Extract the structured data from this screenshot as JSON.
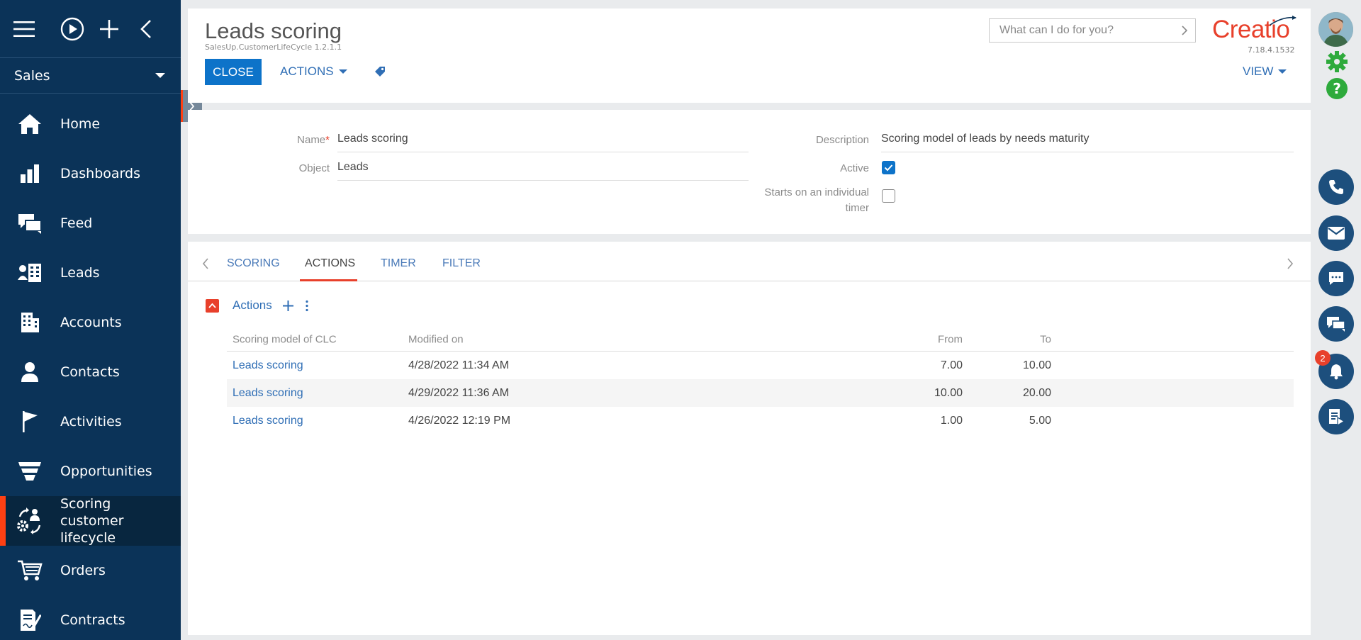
{
  "sidebar": {
    "workspace": "Sales",
    "items": [
      {
        "label": "Home",
        "icon": "home-icon"
      },
      {
        "label": "Dashboards",
        "icon": "dashboards-icon"
      },
      {
        "label": "Feed",
        "icon": "feed-icon"
      },
      {
        "label": "Leads",
        "icon": "leads-icon"
      },
      {
        "label": "Accounts",
        "icon": "accounts-icon"
      },
      {
        "label": "Contacts",
        "icon": "contacts-icon"
      },
      {
        "label": "Activities",
        "icon": "flag-icon"
      },
      {
        "label": "Opportunities",
        "icon": "funnel-icon"
      },
      {
        "label": "Scoring customer lifecycle",
        "icon": "scoring-icon",
        "active": true
      },
      {
        "label": "Orders",
        "icon": "cart-icon"
      },
      {
        "label": "Contracts",
        "icon": "contract-icon"
      }
    ]
  },
  "header": {
    "title": "Leads scoring",
    "subtitle": "SalesUp.CustomerLifeCycle 1.2.1.1",
    "close_label": "CLOSE",
    "actions_label": "ACTIONS",
    "view_label": "VIEW",
    "search_placeholder": "What can I do for you?",
    "logo_text": "Creatio",
    "version": "7.18.4.1532"
  },
  "form": {
    "name_label": "Name",
    "name_required_mark": "*",
    "name_value": "Leads scoring",
    "object_label": "Object",
    "object_value": "Leads",
    "description_label": "Description",
    "description_value": "Scoring model of leads by needs maturity",
    "active_label": "Active",
    "active_checked": true,
    "timer_label_line1": "Starts on an individual",
    "timer_label_line2": "timer",
    "timer_checked": false
  },
  "tabs": [
    "SCORING",
    "ACTIONS",
    "TIMER",
    "FILTER"
  ],
  "active_tab": "ACTIONS",
  "detail": {
    "title": "Actions",
    "columns": [
      "Scoring model of CLC",
      "Modified on",
      "From",
      "To"
    ],
    "rows": [
      [
        "Leads scoring",
        "4/28/2022 11:34 AM",
        "7.00",
        "10.00"
      ],
      [
        "Leads scoring",
        "4/29/2022 11:36 AM",
        "10.00",
        "20.00"
      ],
      [
        "Leads scoring",
        "4/26/2022 12:19 PM",
        "1.00",
        "5.00"
      ]
    ]
  },
  "rail": {
    "notification_count": "2"
  },
  "colors": {
    "sidebar_bg": "#0b3358",
    "accent": "#e8402b",
    "primary": "#0d73c9",
    "link": "#2f6eb5"
  }
}
